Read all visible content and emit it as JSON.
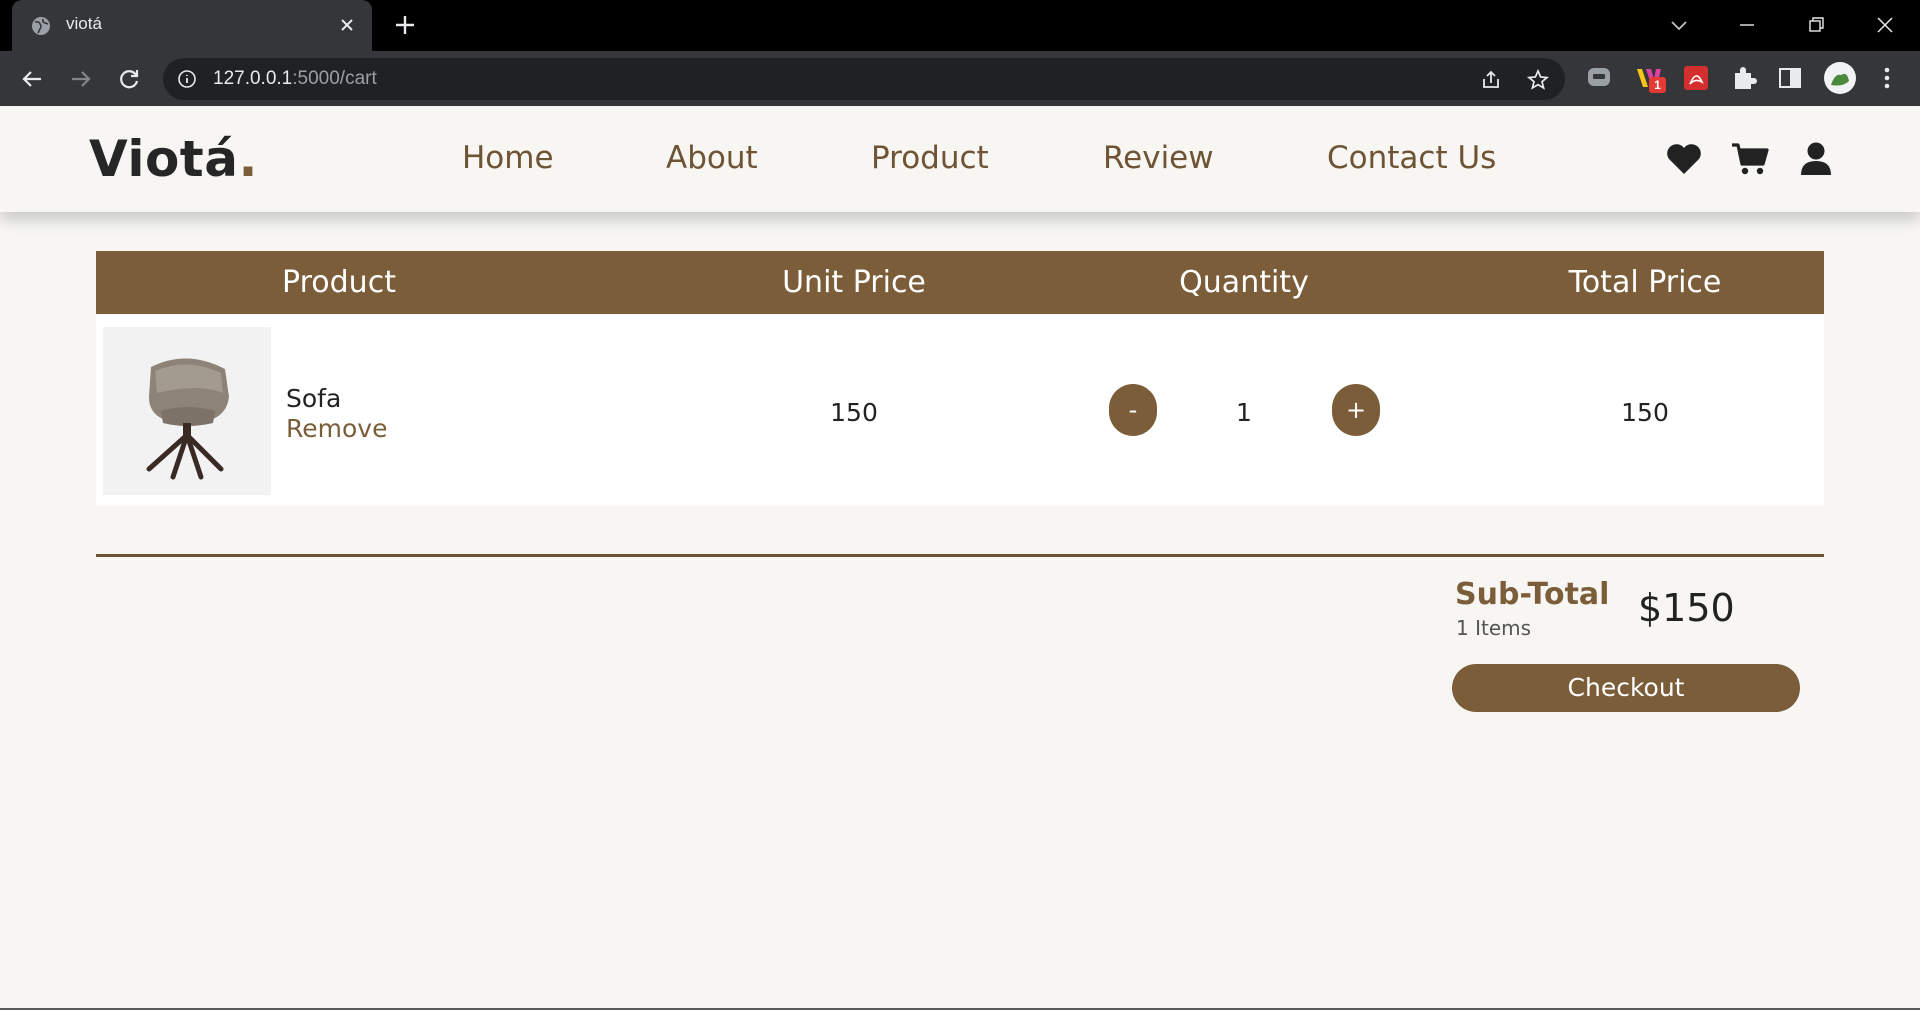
{
  "browser": {
    "tab_title": "viotá",
    "url_host": "127.0.0.1",
    "url_rest": ":5000/cart",
    "extension_badge": "1"
  },
  "header": {
    "logo_text": "Viotá",
    "logo_dot": ".",
    "nav": [
      "Home",
      "About",
      "Product",
      "Review",
      "Contact Us"
    ],
    "icons": [
      "heart-icon",
      "cart-icon",
      "user-icon"
    ]
  },
  "cart": {
    "columns": [
      "Product",
      "Unit Price",
      "Quantity",
      "Total Price"
    ],
    "items": [
      {
        "name": "Sofa",
        "remove_label": "Remove",
        "unit_price": "150",
        "quantity": "1",
        "decrement_label": "-",
        "increment_label": "+",
        "total_price": "150"
      }
    ]
  },
  "summary": {
    "subtotal_label": "Sub-Total",
    "items_count": "1 Items",
    "amount": "$150",
    "checkout_label": "Checkout"
  },
  "colors": {
    "accent": "#7b5d3a",
    "page_bg": "#f7f6f2",
    "chrome_bg": "#35363a"
  }
}
